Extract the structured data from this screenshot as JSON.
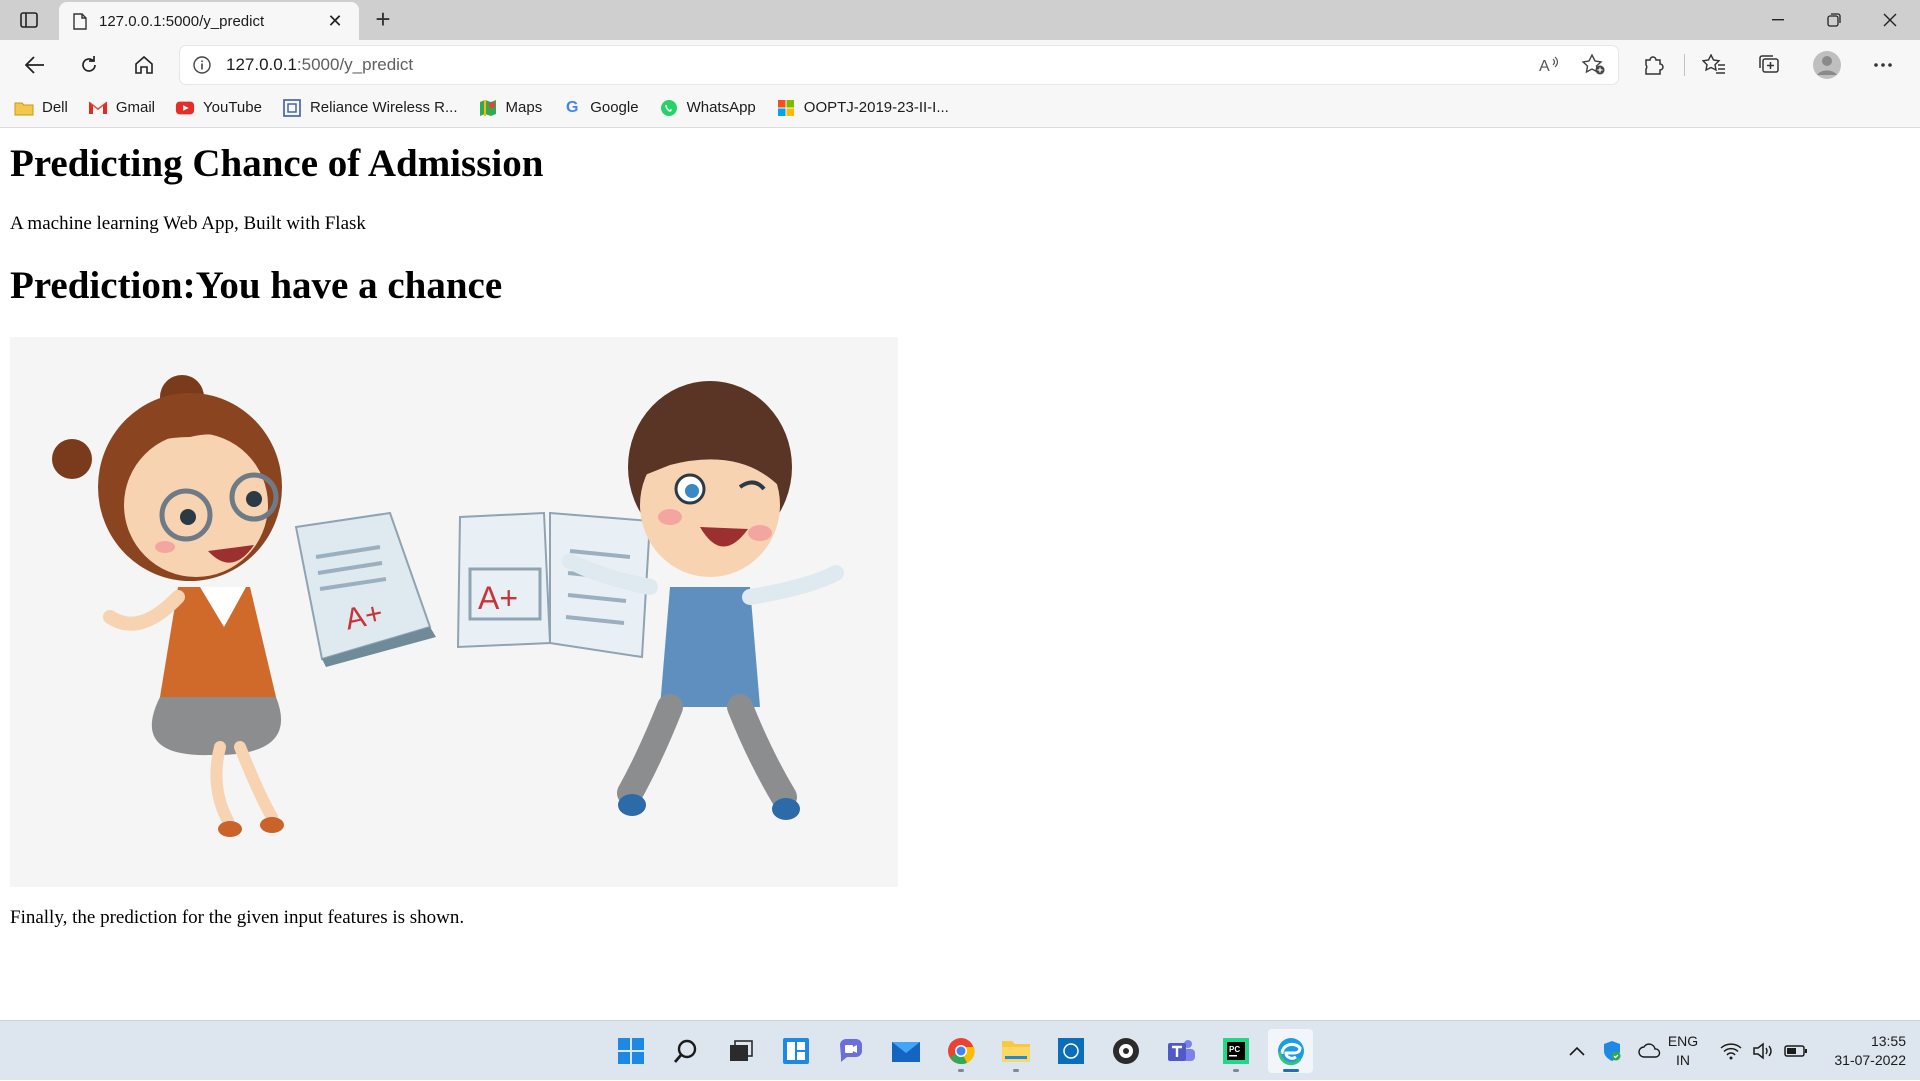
{
  "browser": {
    "tab_title": "127.0.0.1:5000/y_predict",
    "url_host": "127.0.0.1",
    "url_path": ":5000/y_predict"
  },
  "bookmarks": [
    {
      "label": "Dell",
      "icon": "folder-icon"
    },
    {
      "label": "Gmail",
      "icon": "gmail-icon"
    },
    {
      "label": "YouTube",
      "icon": "youtube-icon"
    },
    {
      "label": "Reliance Wireless R...",
      "icon": "page-icon"
    },
    {
      "label": "Maps",
      "icon": "maps-icon"
    },
    {
      "label": "Google",
      "icon": "google-icon"
    },
    {
      "label": "WhatsApp",
      "icon": "whatsapp-icon"
    },
    {
      "label": "OOPTJ-2019-23-II-I...",
      "icon": "office-icon"
    }
  ],
  "page": {
    "title": "Predicting Chance of Admission",
    "subtitle": "A machine learning Web App, Built with Flask",
    "prediction": "Prediction:You have a chance",
    "image_text_left": "A+",
    "image_text_right": "A+",
    "footer": "Finally, the prediction for the given input features is shown."
  },
  "tray": {
    "lang_top": "ENG",
    "lang_bottom": "IN",
    "time": "13:55",
    "date": "31-07-2022"
  },
  "colors": {
    "tabstrip": "#cfcfcf",
    "toolbar": "#f7f7f7",
    "taskbar": "#dde6ee",
    "accent": "#1f6fbf"
  }
}
